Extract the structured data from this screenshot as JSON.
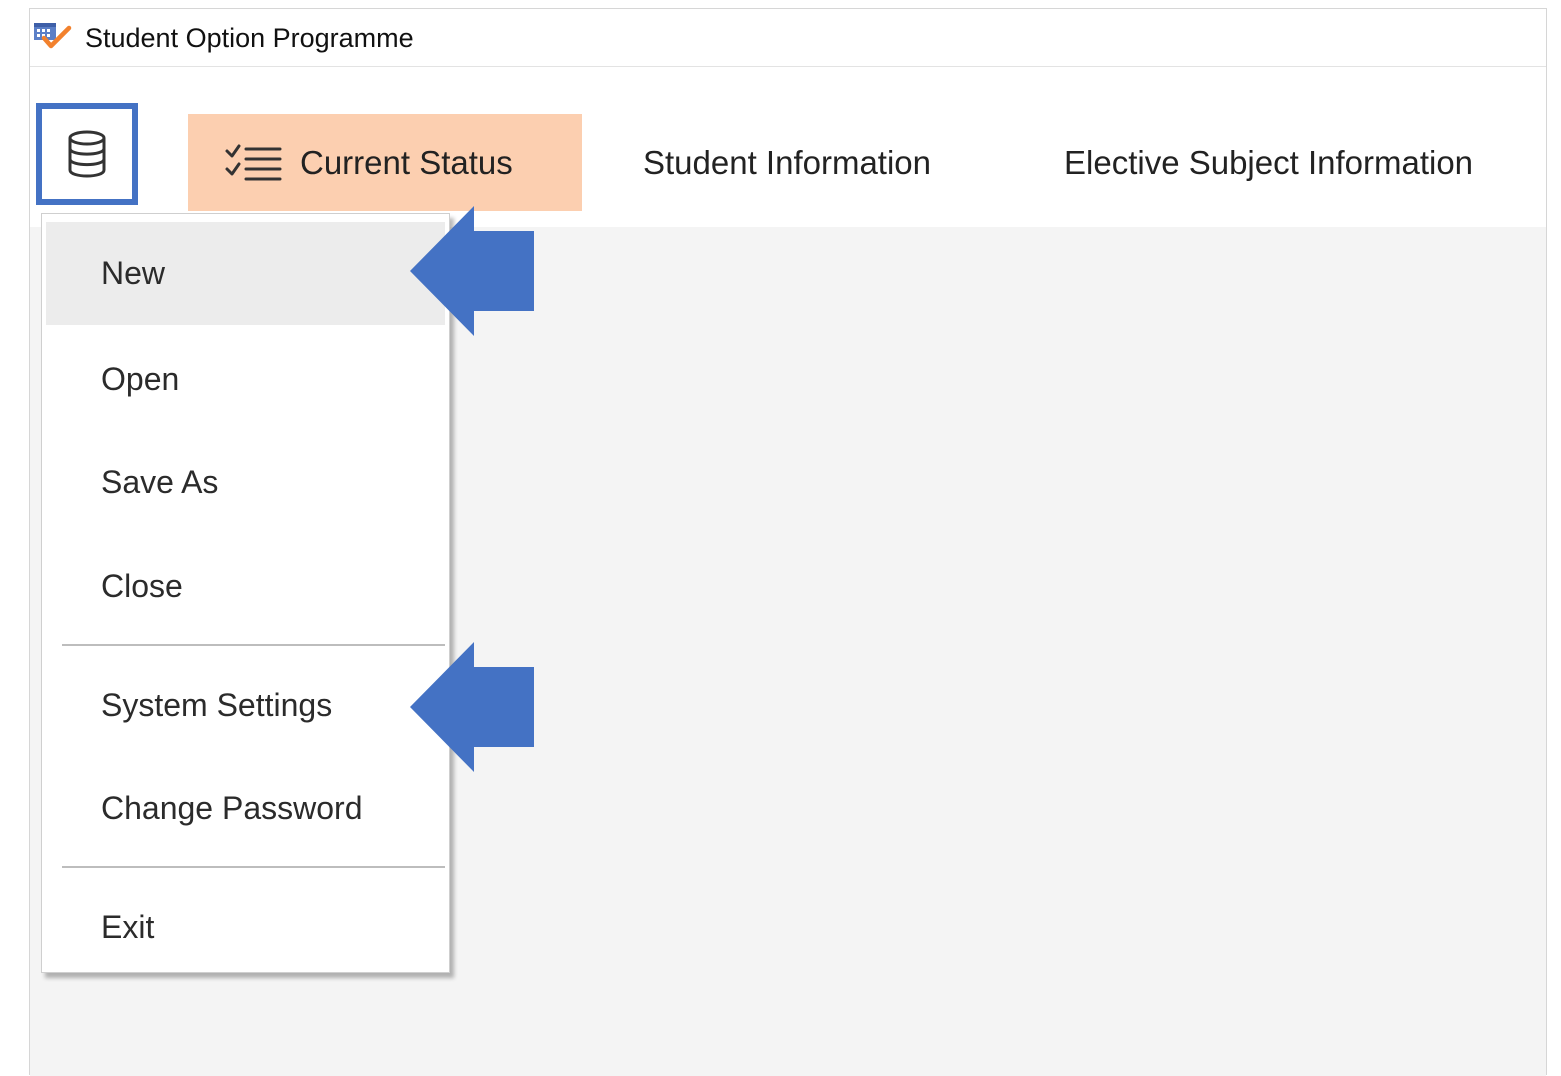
{
  "window": {
    "title": "Student Option Programme",
    "icon": "app-calendar-check-icon"
  },
  "ribbon": {
    "db_button_icon": "database-icon",
    "tabs": [
      {
        "label": "Current Status",
        "icon": "checklist-icon",
        "active": true
      },
      {
        "label": "Student Information",
        "active": false
      },
      {
        "label": "Elective Subject Information",
        "active": false
      }
    ]
  },
  "menu": {
    "items": [
      "New",
      "Open",
      "Save As",
      "Close",
      "System Settings",
      "Change Password",
      "Exit"
    ],
    "highlighted": "New"
  },
  "annotations": {
    "arrow_icon": "left-arrow-icon",
    "arrows_point_to": [
      "New",
      "System Settings"
    ]
  },
  "colors": {
    "highlight_box": "#4472c4",
    "active_tab": "#fccfb0",
    "arrow": "#4472c4",
    "content_bg": "#f4f4f4"
  }
}
